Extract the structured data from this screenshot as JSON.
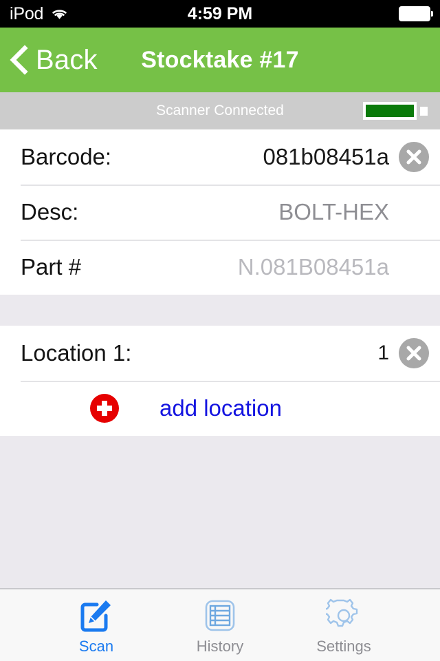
{
  "status_bar": {
    "carrier": "iPod",
    "time": "4:59 PM",
    "wifi_icon": "wifi-icon",
    "battery_icon": "battery-full-icon"
  },
  "nav_bar": {
    "back_label": "Back",
    "back_icon": "chevron-left-icon",
    "title": "Stocktake #17",
    "background_color": "#76c147"
  },
  "scanner_status": {
    "label": "Scanner Connected",
    "battery_icon": "scanner-battery-icon",
    "battery_level_percent": 100,
    "battery_color": "#0a7a0a",
    "background_color": "#cccccc"
  },
  "item_card": {
    "rows": [
      {
        "label": "Barcode:",
        "value": "081b08451a",
        "value_style": "filled",
        "has_clear": true,
        "clear_icon": "clear-circle-icon"
      },
      {
        "label": "Desc:",
        "value": "BOLT-HEX",
        "value_style": "muted",
        "has_clear": false
      },
      {
        "label": "Part #",
        "value": "N.081B08451a",
        "value_style": "lighter",
        "has_clear": false
      }
    ]
  },
  "location_card": {
    "rows": [
      {
        "label": "Location 1:",
        "value": "1",
        "value_style": "qty",
        "has_clear": true,
        "clear_icon": "clear-circle-icon"
      }
    ],
    "add_action": {
      "label": "add location",
      "icon": "add-plus-circle-icon",
      "icon_color": "#e60000",
      "label_color": "#1414e0"
    }
  },
  "tab_bar": {
    "tabs": [
      {
        "label": "Scan",
        "icon": "compose-scan-icon",
        "active": true
      },
      {
        "label": "History",
        "icon": "list-history-icon",
        "active": false
      },
      {
        "label": "Settings",
        "icon": "gear-settings-icon",
        "active": false
      }
    ],
    "active_color": "#1a7af0",
    "inactive_color": "#8e8e93"
  }
}
